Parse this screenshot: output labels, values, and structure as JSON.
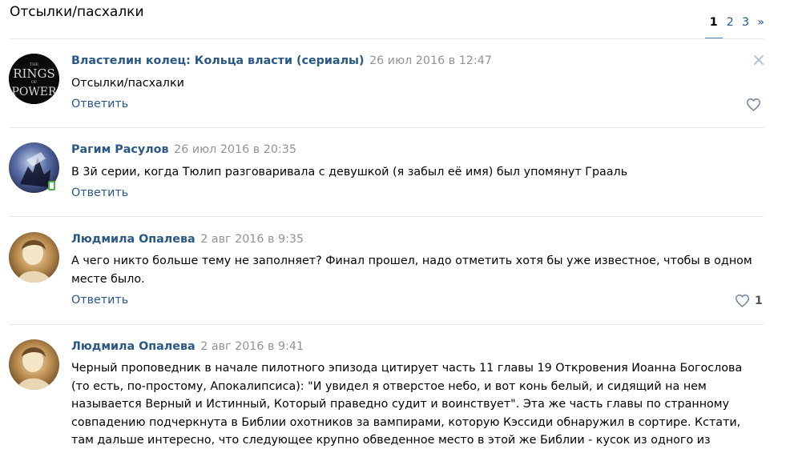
{
  "page": {
    "title": "Отсылки/пасхалки"
  },
  "pagination": {
    "pages": [
      "1",
      "2",
      "3"
    ],
    "current": "1",
    "next": "»"
  },
  "posts": [
    {
      "author": "Властелин колец: Кольца власти (сериалы)",
      "date": "26 июл 2016 в 12:47",
      "text": "Отсылки/пасхалки",
      "reply": "Ответить",
      "avatar_text": [
        "THE",
        "RINGS",
        "OF",
        "POWER"
      ]
    },
    {
      "author": "Рагим Расулов",
      "date": "26 июл 2016 в 20:35",
      "text": "В 3й серии, когда Тюлип разговаривала с девушкой (я забыл её имя) был упомянут Грааль",
      "reply": "Ответить"
    },
    {
      "author": "Людмила Опалева",
      "date": "2 авг 2016 в 9:35",
      "text": "А чего никто больше тему не заполняет? Финал прошел, надо отметить хотя бы уже известное, чтобы в одном месте было.",
      "reply": "Ответить",
      "likes": "1"
    },
    {
      "author": "Людмила Опалева",
      "date": "2 авг 2016 в 9:41",
      "text": "Черный проповедник в начале пилотного эпизода цитирует часть 11 главы 19 Откровения Иоанна Богослова (то есть, по-простому, Апокалипсиса): \"И увидел я отверстое небо, и вот конь белый, и сидящий на нем называется Верный и Истинный, Который праведно судит и воинствует\". Эта же часть главы по странному совпадению подчеркнута в Библии охотников за вампирами, которую Кэссиди обнаружил в сортире. Кстати, там дальше интересно, что следующее крупно обведенное место в этой же Библии - кусок из одного из"
    }
  ]
}
